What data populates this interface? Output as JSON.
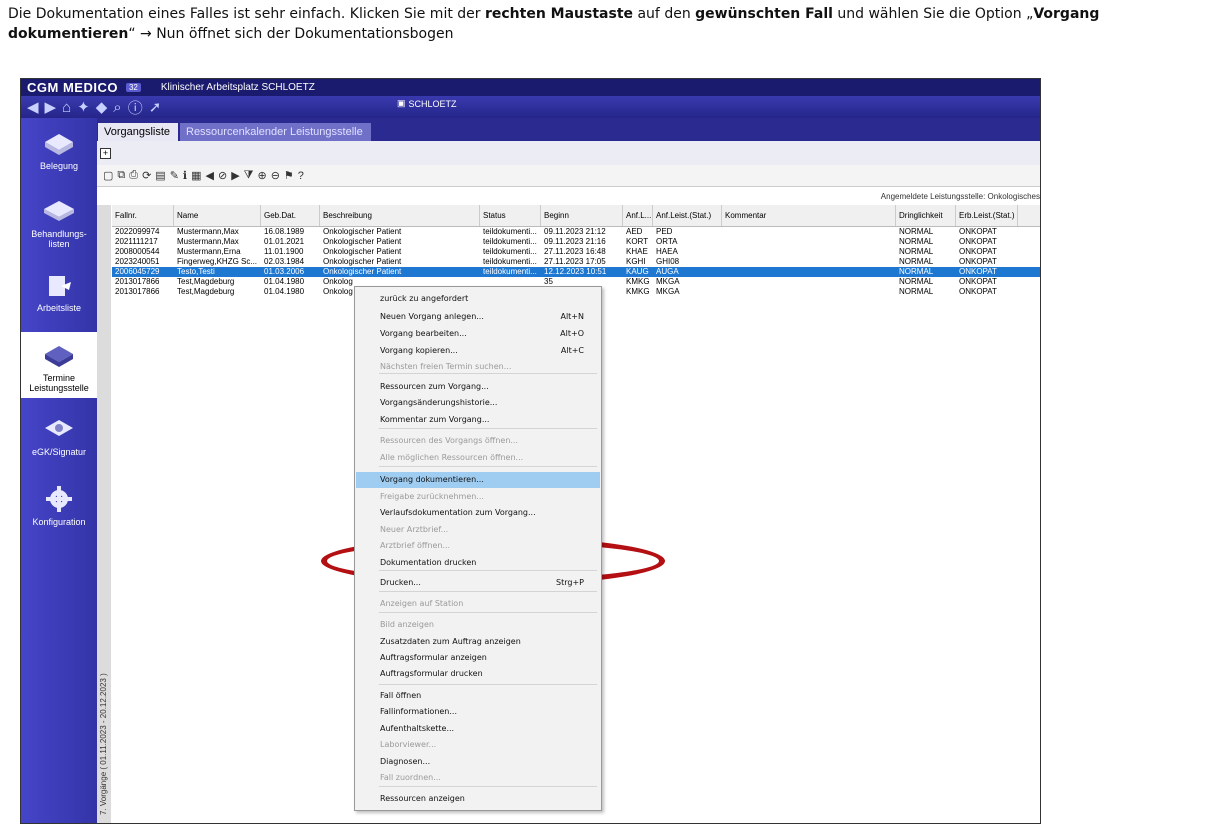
{
  "instruction": {
    "part1": "Die Dokumentation eines Falles ist sehr einfach. Klicken Sie mit der ",
    "bold1": "rechten Maustaste",
    "part2": " auf den ",
    "bold2": "gewünschten Fall",
    "part3": " und wählen Sie die Option „",
    "bold3": "Vorgang dokumentieren",
    "part4": "“ → Nun öffnet sich der Dokumentationsbogen"
  },
  "titlebar": {
    "brand": "CGM MEDICO",
    "badge": "32",
    "title": "Klinischer Arbeitsplatz SCHLOETZ"
  },
  "toolbar": {
    "user": "SCHLOETZ"
  },
  "sidebar": {
    "items": [
      {
        "label": "Belegung",
        "icon": "bed-icon"
      },
      {
        "label": "Behandlungs-listen",
        "icon": "list-tray-icon"
      },
      {
        "label": "Arbeitsliste",
        "icon": "worklist-icon"
      },
      {
        "label": "Termine Leistungsstelle",
        "icon": "calendar-icon"
      },
      {
        "label": "eGK/Signatur",
        "icon": "card-icon"
      },
      {
        "label": "Konfiguration",
        "icon": "gear-icon"
      }
    ]
  },
  "tabs": [
    "Vorgangsliste",
    "Ressourcenkalender Leistungsstelle"
  ],
  "status_line": "Angemeldete Leistungsstelle: Onkologisches",
  "side_label": "7. Vorgänge ( 01.11.2023 - 20.12.2023 )",
  "table": {
    "columns": [
      "Fallnr.",
      "Name",
      "Geb.Dat.",
      "Beschreibung",
      "Status",
      "Beginn",
      "Anf.L...",
      "Anf.Leist.(Stat.)",
      "Kommentar",
      "Dringlichkeit",
      "Erb.Leist.(Stat.)"
    ],
    "rows": [
      [
        "2022099974",
        "Mustermann,Max",
        "16.08.1989",
        "Onkologischer Patient",
        "teildokumenti...",
        "09.11.2023 21:12",
        "AED",
        "PED",
        "",
        "NORMAL",
        "ONKOPAT"
      ],
      [
        "2021111217",
        "Mustermann,Max",
        "01.01.2021",
        "Onkologischer Patient",
        "teildokumenti...",
        "09.11.2023 21:16",
        "KORT",
        "ORTA",
        "",
        "NORMAL",
        "ONKOPAT"
      ],
      [
        "2008000544",
        "Mustermann,Erna",
        "11.01.1900",
        "Onkologischer Patient",
        "teildokumenti...",
        "27.11.2023 16:48",
        "KHAE",
        "HAEA",
        "",
        "NORMAL",
        "ONKOPAT"
      ],
      [
        "2023240051",
        "Fingerweg,KHZG Sc...",
        "02.03.1984",
        "Onkologischer Patient",
        "teildokumenti...",
        "27.11.2023 17:05",
        "KGHI",
        "GHI08",
        "",
        "NORMAL",
        "ONKOPAT"
      ],
      [
        "2006045729",
        "Testo,Testi",
        "01.03.2006",
        "Onkologischer Patient",
        "teildokumenti...",
        "12.12.2023 10:51",
        "KAUG",
        "AUGA",
        "",
        "NORMAL",
        "ONKOPAT"
      ],
      [
        "2013017866",
        "Test,Magdeburg",
        "01.04.1980",
        "Onkolog",
        "",
        "35",
        "KMKG",
        "MKGA",
        "",
        "NORMAL",
        "ONKOPAT"
      ],
      [
        "2013017866",
        "Test,Magdeburg",
        "01.04.1980",
        "Onkolog",
        "",
        "35",
        "KMKG",
        "MKGA",
        "",
        "NORMAL",
        "ONKOPAT"
      ]
    ],
    "selected_row": 4
  },
  "context_menu": {
    "items": [
      {
        "label": "zurück zu angefordert",
        "shortcut": "",
        "disabled": false
      },
      {
        "label": "Neuen Vorgang anlegen...",
        "shortcut": "Alt+N",
        "disabled": false
      },
      {
        "label": "Vorgang bearbeiten...",
        "shortcut": "Alt+O",
        "disabled": false
      },
      {
        "label": "Vorgang kopieren...",
        "shortcut": "Alt+C",
        "disabled": false
      },
      {
        "label": "Nächsten freien Termin suchen...",
        "shortcut": "",
        "disabled": true
      },
      {
        "label": "Ressourcen zum Vorgang...",
        "shortcut": "",
        "disabled": false
      },
      {
        "label": "Vorgangsänderungshistorie...",
        "shortcut": "",
        "disabled": false
      },
      {
        "label": "Kommentar zum Vorgang...",
        "shortcut": "",
        "disabled": false
      },
      {
        "label": "Ressourcen des Vorgangs öffnen...",
        "shortcut": "",
        "disabled": true
      },
      {
        "label": "Alle möglichen Ressourcen öffnen...",
        "shortcut": "",
        "disabled": true
      },
      {
        "label": "Vorgang dokumentieren...",
        "shortcut": "",
        "disabled": false
      },
      {
        "label": "Freigabe zurücknehmen...",
        "shortcut": "",
        "disabled": true
      },
      {
        "label": "Verlaufsdokumentation zum Vorgang...",
        "shortcut": "",
        "disabled": false
      },
      {
        "label": "Neuer Arztbrief...",
        "shortcut": "",
        "disabled": true
      },
      {
        "label": "Arztbrief öffnen...",
        "shortcut": "",
        "disabled": true
      },
      {
        "label": "Dokumentation drucken",
        "shortcut": "",
        "disabled": false
      },
      {
        "label": "Drucken...",
        "shortcut": "Strg+P",
        "disabled": false
      },
      {
        "label": "Anzeigen auf Station",
        "shortcut": "",
        "disabled": true
      },
      {
        "label": "Bild anzeigen",
        "shortcut": "",
        "disabled": true
      },
      {
        "label": "Zusatzdaten zum Auftrag anzeigen",
        "shortcut": "",
        "disabled": false
      },
      {
        "label": "Auftragsformular anzeigen",
        "shortcut": "",
        "disabled": false
      },
      {
        "label": "Auftragsformular drucken",
        "shortcut": "",
        "disabled": false
      },
      {
        "label": "Fall öffnen",
        "shortcut": "",
        "disabled": false
      },
      {
        "label": "Fallinformationen...",
        "shortcut": "",
        "disabled": false
      },
      {
        "label": "Aufenthaltskette...",
        "shortcut": "",
        "disabled": false
      },
      {
        "label": "Laborviewer...",
        "shortcut": "",
        "disabled": true
      },
      {
        "label": "Diagnosen...",
        "shortcut": "",
        "disabled": false
      },
      {
        "label": "Fall zuordnen...",
        "shortcut": "",
        "disabled": true
      },
      {
        "label": "Ressourcen anzeigen",
        "shortcut": "",
        "disabled": false
      }
    ],
    "highlighted": 10
  },
  "colors": {
    "accent": "#1e78d2",
    "sidebar": "#3a3ab8",
    "highlight": "#9fcdf2",
    "annotation_ring": "#b40f12"
  }
}
